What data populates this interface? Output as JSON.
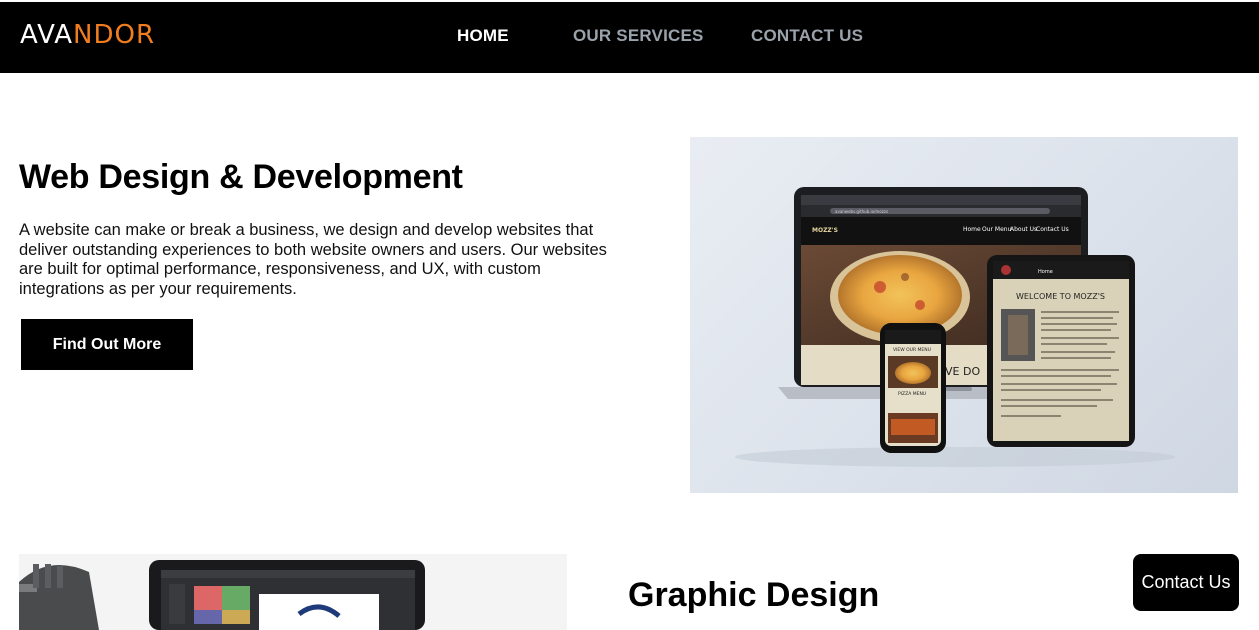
{
  "header": {
    "logo": {
      "part1": "AVA",
      "part2": "NDOR",
      "accent_color": "#f07d1e"
    },
    "nav": [
      {
        "label": "HOME",
        "active": true
      },
      {
        "label": "OUR SERVICES",
        "active": false
      },
      {
        "label": "CONTACT US",
        "active": false
      }
    ]
  },
  "section1": {
    "title": "Web Design & Development",
    "body": "A website can make or break a business, we design and develop websites that deliver outstanding experiences to both website owners and users. Our websites are built for optimal performance, responsiveness, and UX, with custom integrations as per your requirements.",
    "button": "Find Out More",
    "image": {
      "browser_url": "avanwebs.github.io/mozzs",
      "site_name": "MOZZ'S",
      "site_nav": [
        "Home",
        "Our Menu",
        "About Us",
        "Contact Us"
      ],
      "tablet_heading": "WELCOME TO MOZZ'S",
      "phone_heading": "VIEW OUR MENU",
      "phone_label": "PIZZA MENU",
      "laptop_text": "VE DO"
    }
  },
  "section2": {
    "title": "Graphic Design"
  },
  "floating_button": "Contact Us"
}
